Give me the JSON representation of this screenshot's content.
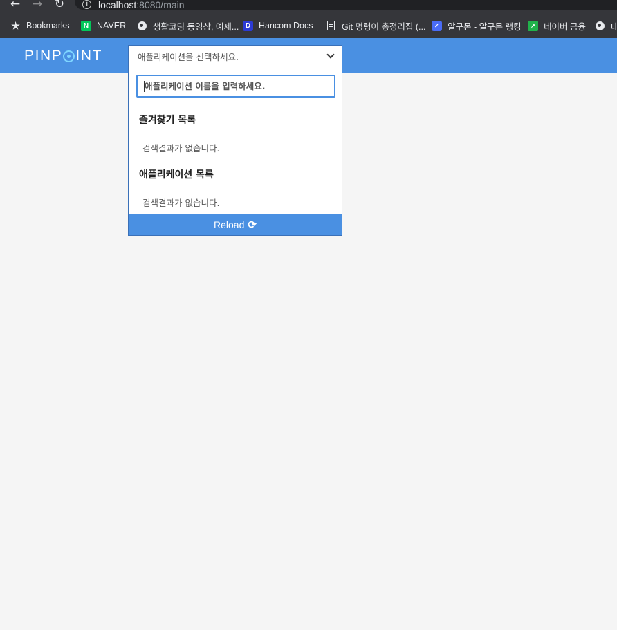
{
  "browser": {
    "url_host": "localhost",
    "url_rest": ":8080/main",
    "bookmarks": [
      {
        "label": "Bookmarks",
        "icon": "star-icon"
      },
      {
        "label": "NAVER",
        "icon": "naver-icon",
        "glyph": "N"
      },
      {
        "label": "생활코딩 동영상, 예제...",
        "icon": "globe-icon"
      },
      {
        "label": "Hancom Docs",
        "icon": "hancom-icon",
        "glyph": "D"
      },
      {
        "label": "Git 명령어 총정리집 (...",
        "icon": "document-icon"
      },
      {
        "label": "알구몬 - 알구몬 랭킹",
        "icon": "algumon-icon",
        "glyph": "✓"
      },
      {
        "label": "네이버 금융",
        "icon": "finance-icon",
        "glyph": "↗"
      },
      {
        "label": "대",
        "icon": "globe-icon"
      }
    ]
  },
  "header": {
    "logo_left": "PINP",
    "logo_right": "INT",
    "app_select_label": "애플리케이션을 선택하세요."
  },
  "dropdown": {
    "search_placeholder": "애플리케이션 이름을 입력하세요.",
    "favorites_title": "즐겨찾기 목록",
    "favorites_empty": "검색결과가 없습니다.",
    "apps_title": "애플리케이션 목록",
    "apps_empty": "검색결과가 없습니다.",
    "reload_label": "Reload",
    "reload_icon": "refresh-icon"
  },
  "colors": {
    "header_blue": "#4a90e2",
    "page_bg": "#f5f5f5"
  }
}
